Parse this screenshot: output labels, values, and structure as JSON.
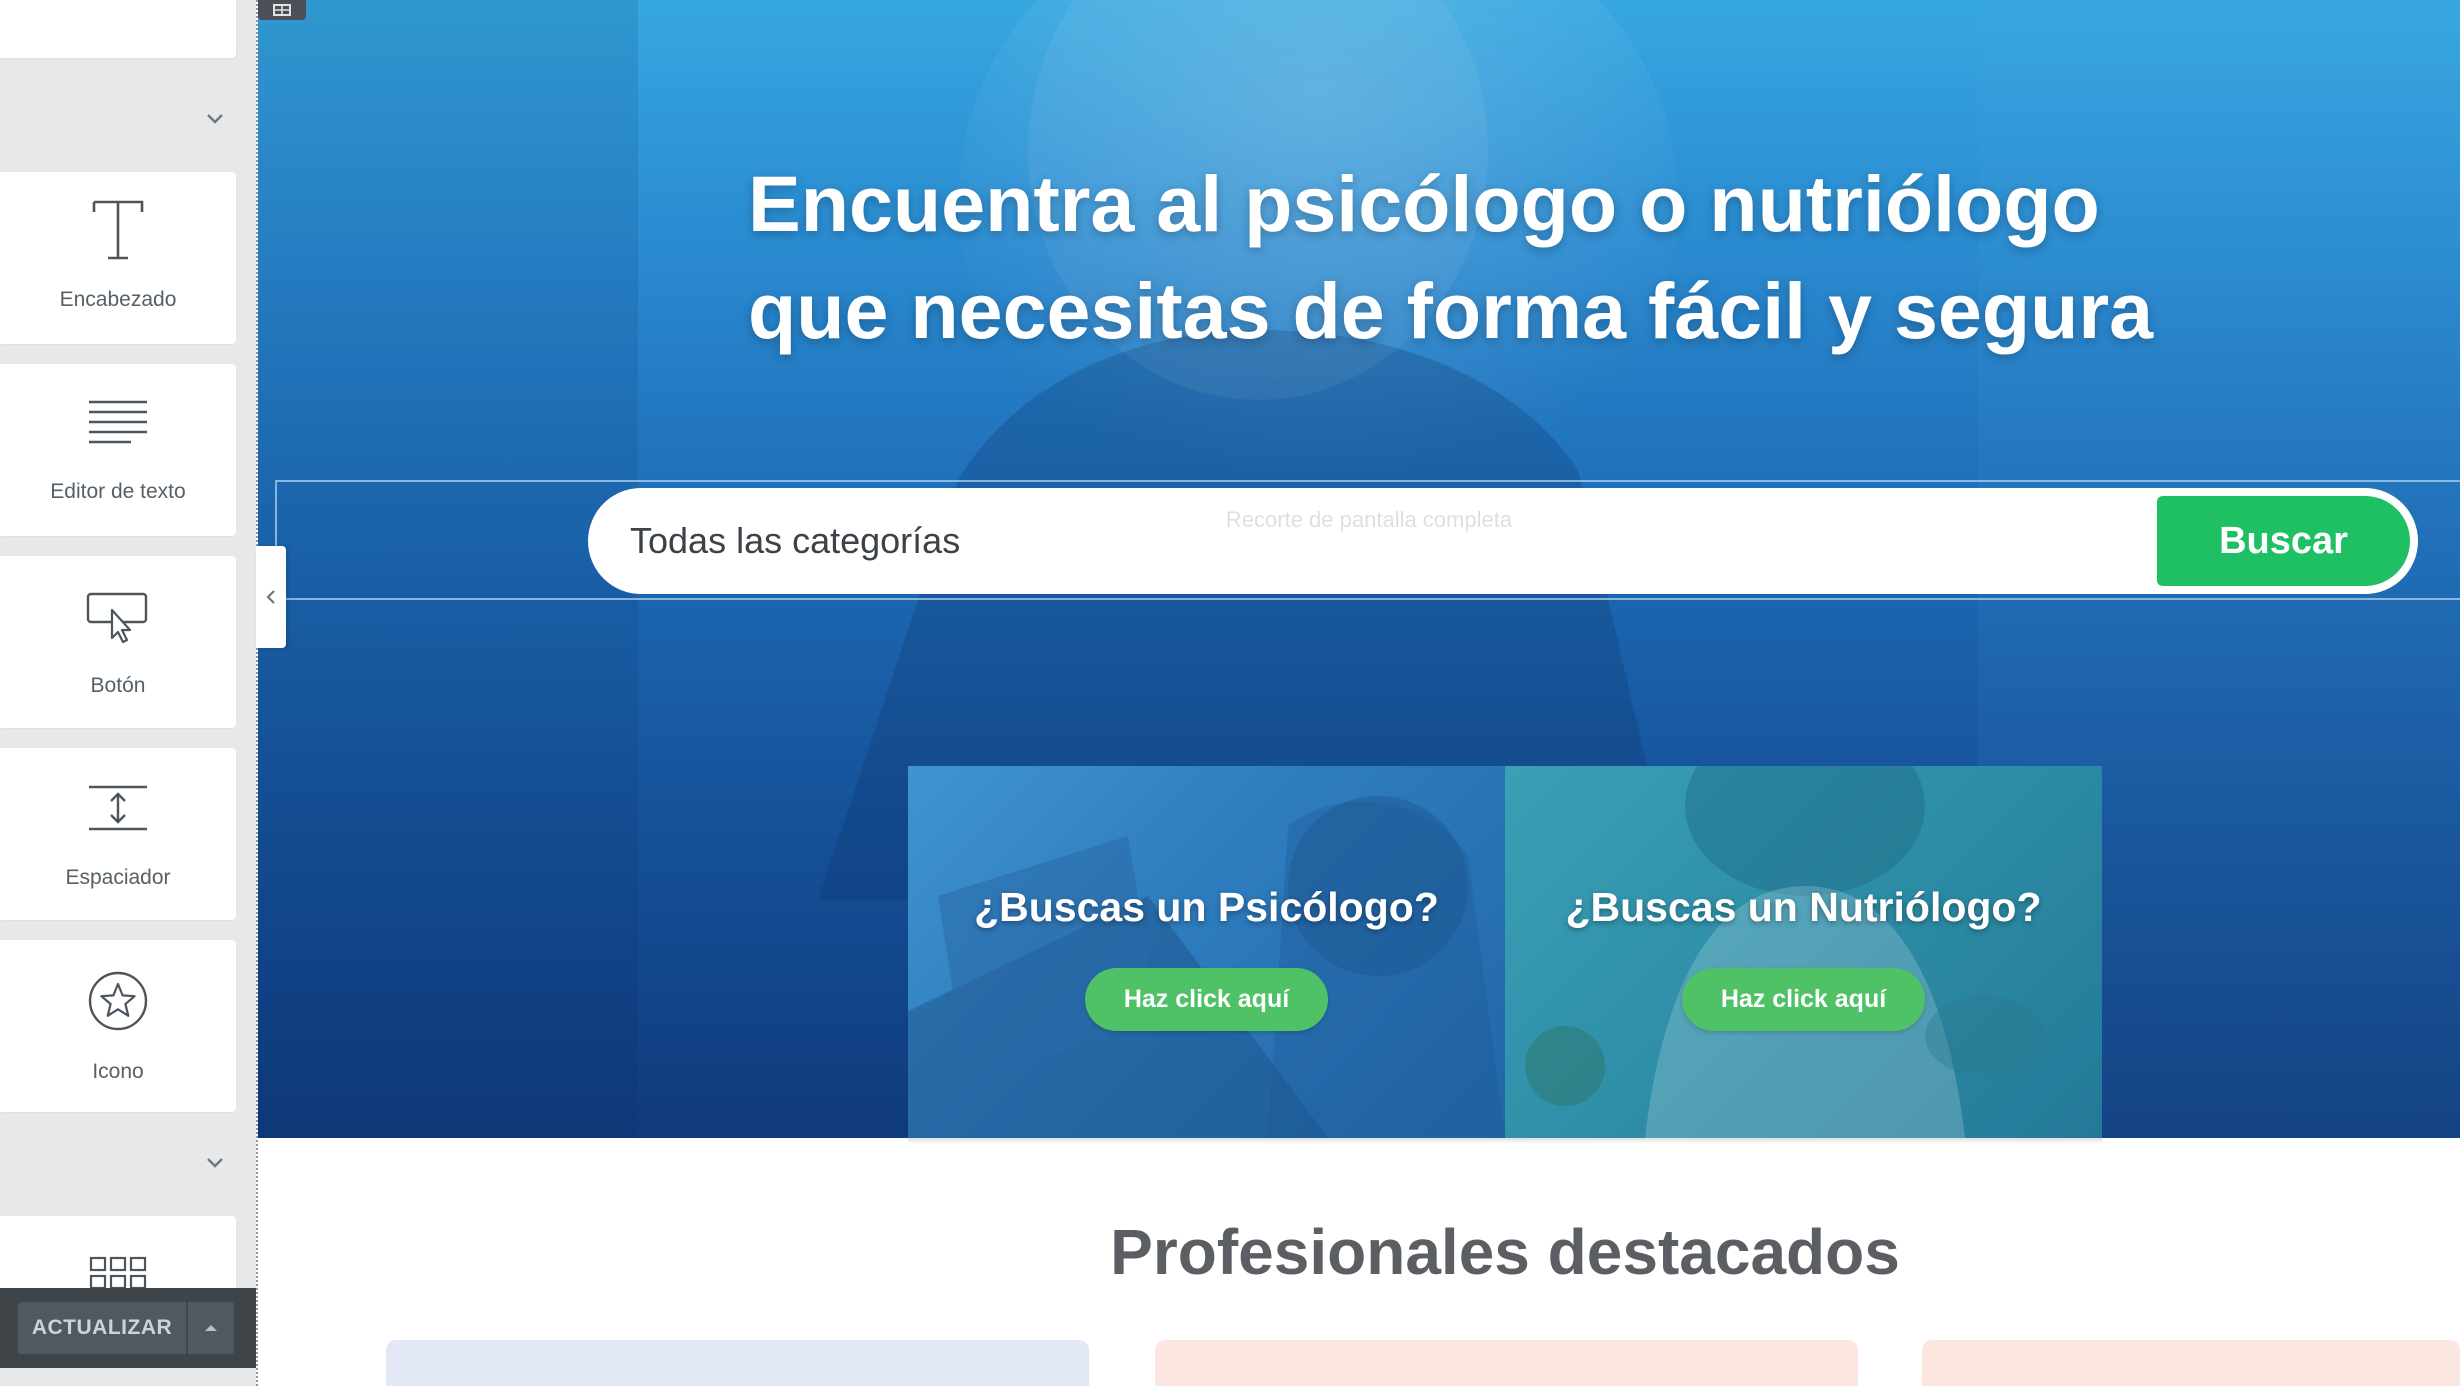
{
  "sidebar": {
    "widgets": [
      {
        "label": "Encabezado",
        "icon": "heading-icon"
      },
      {
        "label": "Editor de texto",
        "icon": "text-editor-icon"
      },
      {
        "label": "Botón",
        "icon": "button-icon"
      },
      {
        "label": "Espaciador",
        "icon": "spacer-icon"
      },
      {
        "label": "Icono",
        "icon": "star-icon"
      }
    ],
    "next_widget_icon": "grid-icon",
    "update_label": "ACTUALIZAR"
  },
  "hero": {
    "title_line1": "Encuentra al psicólogo o nutriólogo",
    "title_line2": "que necesitas de forma fácil y segura",
    "search": {
      "category_value": "Todas las categorías",
      "ghost_tooltip": "Recorte de pantalla completa",
      "button_label": "Buscar"
    },
    "promos": [
      {
        "title": "¿Buscas un Psicólogo?",
        "button": "Haz click aquí"
      },
      {
        "title": "¿Buscas un Nutriólogo?",
        "button": "Haz click aquí"
      }
    ]
  },
  "featured": {
    "title": "Profesionales destacados"
  },
  "colors": {
    "accent_green": "#1fbf63",
    "promo_button_green": "#4fc167",
    "hero_blue_top": "#36a7e0",
    "hero_blue_bottom": "#0f3a7c",
    "panel_bg": "#e6e8ea",
    "update_bar": "#3f4448"
  }
}
